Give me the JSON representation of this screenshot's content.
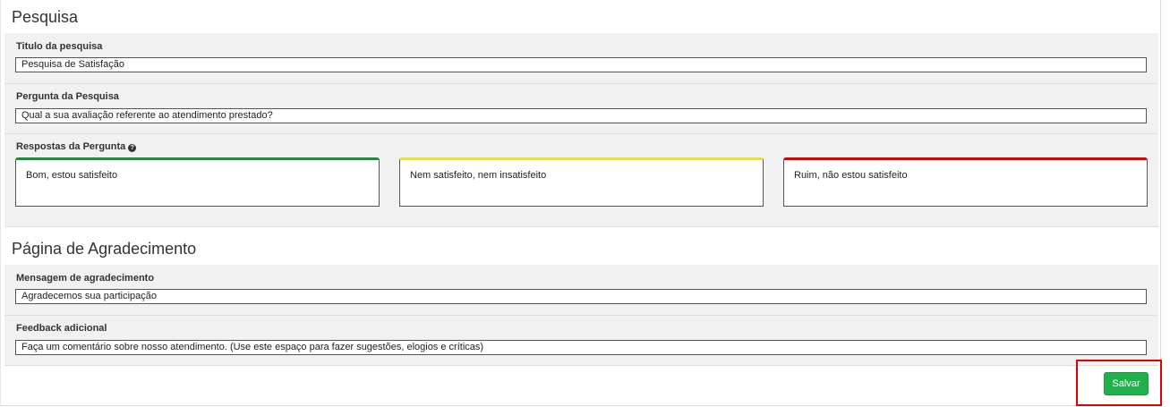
{
  "survey_section": {
    "title": "Pesquisa",
    "survey_title": {
      "label": "Titulo da pesquisa",
      "value": "Pesquisa de Satisfação"
    },
    "survey_question": {
      "label": "Pergunta da Pesquisa",
      "value": "Qual a sua avaliação referente ao atendimento prestado?"
    },
    "answers": {
      "label": "Respostas da Pergunta",
      "help_icon": "question-circle-icon",
      "items": [
        {
          "text": "Bom, estou satisfeito",
          "color": "#1a8f3a"
        },
        {
          "text": "Nem satisfeito, nem insatisfeito",
          "color": "#e8e235"
        },
        {
          "text": "Ruim, não estou satisfeito",
          "color": "#e00000"
        }
      ]
    }
  },
  "thanks_section": {
    "title": "Página de Agradecimento",
    "thanks_message": {
      "label": "Mensagem de agradecimento",
      "value": "Agradecemos sua participação"
    },
    "extra_feedback": {
      "label": "Feedback adicional",
      "value": "Faça um comentário sobre nosso atendimento. (Use este espaço para fazer sugestões, elogios e críticas)"
    }
  },
  "actions": {
    "save_label": "Salvar",
    "save_color": "#21b14c",
    "highlight_color": "#e00000"
  }
}
